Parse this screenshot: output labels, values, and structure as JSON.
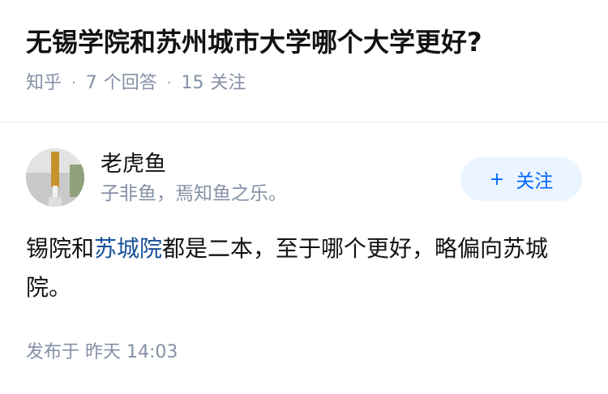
{
  "question": {
    "title": "无锡学院和苏州城市大学哪个大学更好?",
    "source": "知乎",
    "answer_count": "7",
    "answer_label": "个回答",
    "follow_count": "15",
    "follow_label": "关注"
  },
  "answer": {
    "author_name": "老虎鱼",
    "author_bio": "子非鱼，焉知鱼之乐。",
    "follow_button": {
      "icon": "+",
      "label": "关注"
    },
    "content_before": "锡院和",
    "content_link": "苏城院",
    "content_after": "都是二本，至于哪个更好，略偏向苏城院。",
    "posted_prefix": "发布于",
    "posted_time": "昨天 14:03"
  },
  "colors": {
    "text_primary": "#121212",
    "text_secondary": "#8590a6",
    "link": "#175199",
    "accent": "#0066ff",
    "button_bg": "#ebf5ff"
  }
}
